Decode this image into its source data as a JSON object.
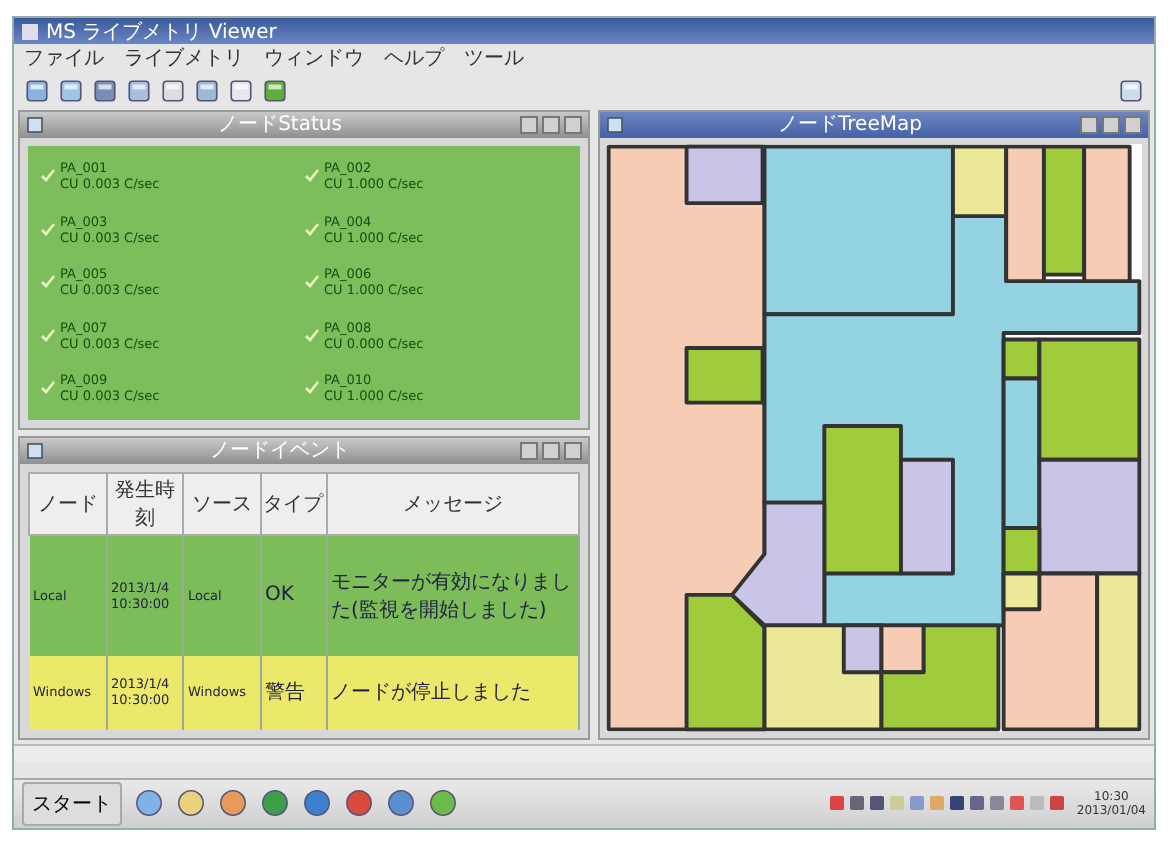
{
  "window": {
    "title": "MS ライブメトリ Viewer"
  },
  "menu": [
    "ファイル",
    "ライブメトリ",
    "ウィンドウ",
    "ヘルプ",
    "ツール"
  ],
  "status_panel": {
    "title": "ノードStatus",
    "items": [
      {
        "name": "PA_001",
        "value": "CU  0.003 C/sec"
      },
      {
        "name": "PA_002",
        "value": "CU  1.000 C/sec"
      },
      {
        "name": "PA_003",
        "value": "CU  0.003 C/sec"
      },
      {
        "name": "PA_004",
        "value": "CU  1.000 C/sec"
      },
      {
        "name": "PA_005",
        "value": "CU  0.003 C/sec"
      },
      {
        "name": "PA_006",
        "value": "CU  1.000 C/sec"
      },
      {
        "name": "PA_007",
        "value": "CU  0.003 C/sec"
      },
      {
        "name": "PA_008",
        "value": "CU  0.000 C/sec"
      },
      {
        "name": "PA_009",
        "value": "CU  0.003 C/sec"
      },
      {
        "name": "PA_010",
        "value": "CU  1.000 C/sec"
      }
    ]
  },
  "event_panel": {
    "title": "ノードイベント",
    "table": {
      "columns": [
        "ノード",
        "発生時刻",
        "ソース",
        "タイプ",
        "メッセージ"
      ],
      "rows": [
        {
          "color": "#7cbd59",
          "cells": [
            "Local",
            "2013/1/4\n10:30:00",
            "Local",
            "OK",
            "モニターが有効になりました(監視を開始しました)"
          ]
        },
        {
          "color": "#ebe86a",
          "cells": [
            "Windows",
            "2013/1/4\n10:30:00",
            "Windows",
            "警告",
            "ノードが停止しました"
          ]
        }
      ]
    }
  },
  "treemap_panel": {
    "title": "ノードTreeMap",
    "tiles": [
      {
        "color": "#f6cdb4"
      },
      {
        "color": "#c8c5e6"
      },
      {
        "color": "#9fcb3c"
      },
      {
        "color": "#9fcb3c"
      },
      {
        "color": "#94d3e2"
      },
      {
        "color": "#94d3e2"
      },
      {
        "color": "#9fcb3c"
      },
      {
        "color": "#c8c5e6"
      },
      {
        "color": "#c8c5e6"
      },
      {
        "color": "#ebe898"
      },
      {
        "color": "#f6cdb4"
      },
      {
        "color": "#9fcb3c"
      },
      {
        "color": "#f6cdb4"
      },
      {
        "color": "#9fcb3c"
      },
      {
        "color": "#94d3e2"
      },
      {
        "color": "#9fcb3c"
      },
      {
        "color": "#c8c5e6"
      },
      {
        "color": "#9fcb3c"
      },
      {
        "color": "#f6cdb4"
      },
      {
        "color": "#ebe898"
      },
      {
        "color": "#ebe898"
      },
      {
        "color": "#ebe898"
      },
      {
        "color": "#c8c5e6"
      },
      {
        "color": "#f6cdb4"
      },
      {
        "color": "#9fcb3c"
      }
    ]
  },
  "taskbar": {
    "start": "スタート",
    "clock_time": "10:30",
    "clock_date": "2013/01/04"
  }
}
